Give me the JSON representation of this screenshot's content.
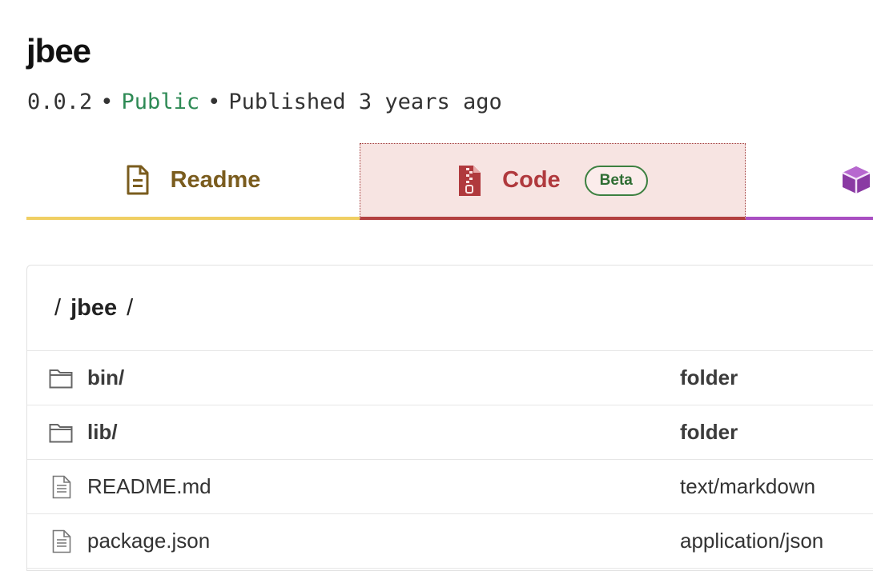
{
  "package": {
    "name": "jbee",
    "version": "0.0.2",
    "separator": "•",
    "visibility": "Public",
    "published": "Published 3 years ago"
  },
  "tabs": [
    {
      "label": "Readme",
      "icon": "file-text-icon",
      "color": "#7a5c1e"
    },
    {
      "label": "Code",
      "icon": "file-zip-icon",
      "badge": "Beta",
      "color": "#b0393d"
    },
    {
      "label": "",
      "icon": "box-icon",
      "color": "#8a3aa3"
    }
  ],
  "browser": {
    "crumb_sep": "/",
    "crumb_segment": "jbee",
    "files": [
      {
        "name": "bin/",
        "type": "folder",
        "icon": "folder-icon"
      },
      {
        "name": "lib/",
        "type": "folder",
        "icon": "folder-icon"
      },
      {
        "name": "README.md",
        "type": "text/markdown",
        "icon": "file-icon"
      },
      {
        "name": "package.json",
        "type": "application/json",
        "icon": "file-icon"
      }
    ]
  },
  "colors": {
    "readme_underline": "#f0cf63",
    "code_underline": "#b34040",
    "code_bg": "#f7e4e2",
    "deps_underline": "#a94fc2",
    "public_green": "#2e8a55"
  }
}
